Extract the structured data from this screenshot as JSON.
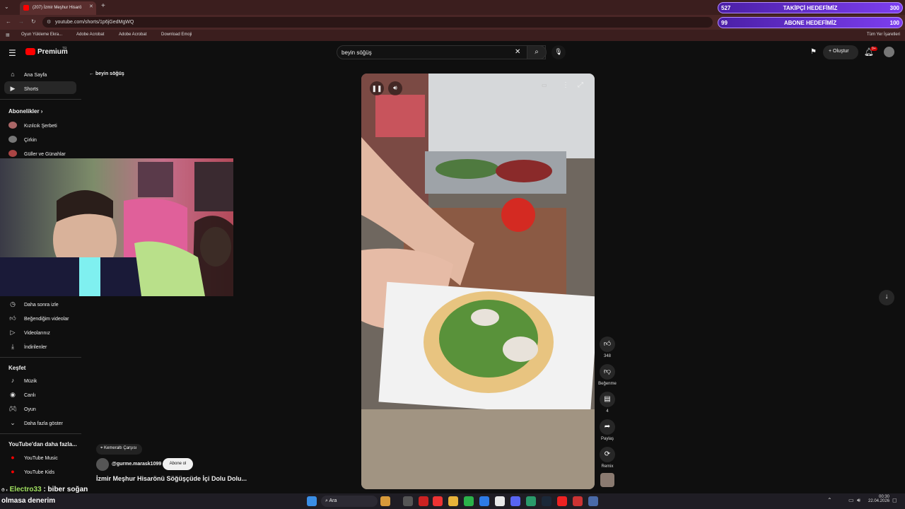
{
  "browser": {
    "tab_title": "(207) İzmir Meşhur Hisarö",
    "url": "youtube.com/shorts/1p6jGedMgWQ",
    "bookmarks": [
      "Oyun Yükleme Ekra...",
      "Adobe Acrobat",
      "Adobe Acrobat",
      "Download Emoji"
    ],
    "all_bookmarks": "Tüm Yer İşaretleri"
  },
  "goals": [
    {
      "current": "527",
      "label": "TAKİPÇİ HEDEFİMİZ",
      "target": "300"
    },
    {
      "current": "99",
      "label": "ABONE HEDEFİMİZ",
      "target": "100"
    }
  ],
  "youtube": {
    "logo": "Premium",
    "logo_sup": "TR",
    "search_query": "beyin söğüş",
    "create_label": "Oluştur",
    "notif_count": "9+",
    "back_label": "beyin söğüş",
    "nav": [
      {
        "label": "Ana Sayfa",
        "icon": "home-icon"
      },
      {
        "label": "Shorts",
        "icon": "shorts-icon"
      }
    ],
    "subs_title": "Abonelikler",
    "subs": [
      {
        "label": "Kızılcık Şerbeti"
      },
      {
        "label": "Çirkin"
      },
      {
        "label": "Güller ve Günahlar"
      }
    ],
    "you_items": [
      {
        "label": "Daha sonra izle",
        "icon": "clock-icon"
      },
      {
        "label": "Beğendiğim videolar",
        "icon": "thumbs-up-icon"
      },
      {
        "label": "Videolarınız",
        "icon": "play-icon"
      },
      {
        "label": "İndirilenler",
        "icon": "download-icon"
      }
    ],
    "explore_title": "Keşfet",
    "explore": [
      {
        "label": "Müzik",
        "icon": "music-icon"
      },
      {
        "label": "Canlı",
        "icon": "live-icon"
      },
      {
        "label": "Oyun",
        "icon": "gamepad-icon"
      },
      {
        "label": "Daha fazla göster",
        "icon": "chevron-down-icon"
      }
    ],
    "more_title": "YouTube'dan daha fazla...",
    "more": [
      {
        "label": "YouTube Music"
      },
      {
        "label": "YouTube Kids"
      }
    ],
    "short": {
      "location": "Kemeraltı Çarşısı",
      "channel": "@gurme.marask1099",
      "subscribe": "Abone ol",
      "title": "İzmir Meşhur Hisarönü Söğüşçüde İçi Dolu Dolu...",
      "likes": "348",
      "dislike_label": "Beğenme",
      "comments": "4",
      "share_label": "Paylaş",
      "remix_label": "Remix"
    }
  },
  "chat": {
    "user": "Electro33",
    "message": ": biber soğan",
    "line2": "olmasa denerim"
  },
  "taskbar": {
    "search": "Ara",
    "time": "00:30",
    "date": "22.04.2026"
  },
  "colors": {
    "accent": "#ff0000",
    "goal": "#7d3ef0"
  }
}
